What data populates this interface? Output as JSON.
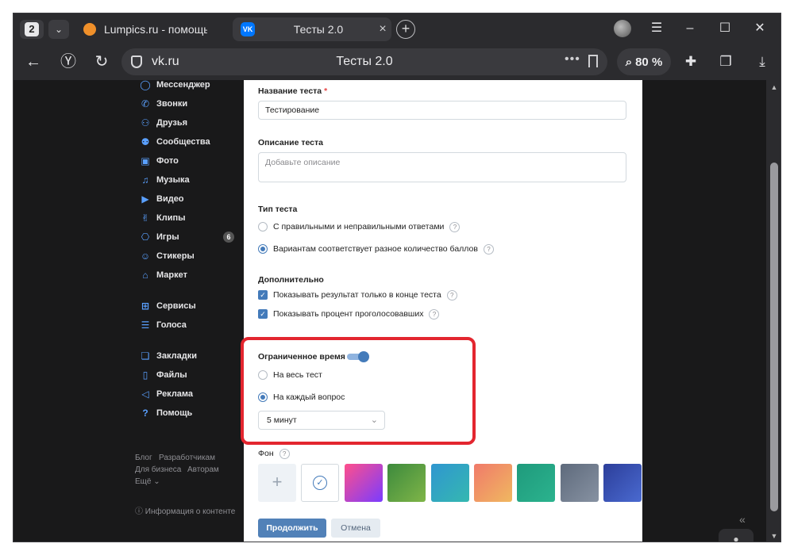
{
  "browser": {
    "tab_count": "2",
    "tabs": [
      {
        "title": "Lumpics.ru - помощь с компьютером"
      },
      {
        "title": "Тесты 2.0"
      }
    ],
    "address": {
      "domain": "vk.ru",
      "page_title": "Тесты 2.0"
    },
    "zoom": "80 %"
  },
  "sidebar": {
    "items": [
      {
        "label": "Мессенджер"
      },
      {
        "label": "Звонки"
      },
      {
        "label": "Друзья"
      },
      {
        "label": "Сообщества"
      },
      {
        "label": "Фото"
      },
      {
        "label": "Музыка"
      },
      {
        "label": "Видео"
      },
      {
        "label": "Клипы"
      },
      {
        "label": "Игры",
        "badge": "6"
      },
      {
        "label": "Стикеры"
      },
      {
        "label": "Маркет"
      },
      {
        "label": "Сервисы"
      },
      {
        "label": "Голоса"
      },
      {
        "label": "Закладки"
      },
      {
        "label": "Файлы"
      },
      {
        "label": "Реклама"
      },
      {
        "label": "Помощь"
      }
    ],
    "footer": {
      "blog": "Блог",
      "developers": "Разработчикам",
      "business": "Для бизнеса",
      "authors": "Авторам",
      "more": "Ещё ⌄",
      "content_info": "Информация о контенте"
    }
  },
  "form": {
    "name_label": "Название теста",
    "name_required": "*",
    "name_value": "Тестирование",
    "description_label": "Описание теста",
    "description_placeholder": "Добавьте описание",
    "type_label": "Тип теста",
    "type_option_1": "С правильными и неправильными ответами",
    "type_option_2": "Вариантам соответствует разное количество баллов",
    "extra_label": "Дополнительно",
    "extra_option_1": "Показывать результат только в конце теста",
    "extra_option_2": "Показывать процент проголосовавших",
    "time_label": "Ограниченное время",
    "time_option_1": "На весь тест",
    "time_option_2": "На каждый вопрос",
    "time_select_value": "5 минут",
    "background_label": "Фон",
    "question_mark": "?",
    "continue_button": "Продолжить",
    "cancel_button": "Отмена"
  },
  "colors": {
    "accent": "#447bba",
    "primary_button": "#5181b8",
    "highlight": "#e3262f",
    "swatches": [
      "linear-gradient(135deg,#ff4f8b,#7a3cff)",
      "linear-gradient(135deg,#3d8a3d,#7fb548)",
      "linear-gradient(135deg,#2f96d0,#35b8b0)",
      "linear-gradient(135deg,#f07a6a,#f0b860)",
      "linear-gradient(135deg,#1f9a7c,#2bb38e)",
      "linear-gradient(135deg,#5e6a7c,#8792a2)",
      "linear-gradient(135deg,#2c3e9a,#4a6ad0)"
    ]
  }
}
